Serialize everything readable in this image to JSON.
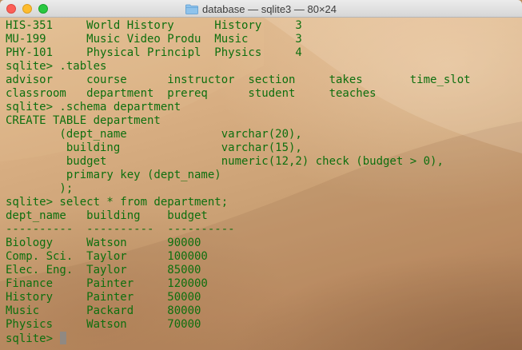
{
  "window": {
    "title": "database — sqlite3 — 80×24"
  },
  "icons": {
    "title": "folder-icon",
    "close": "close-icon",
    "minimize": "minimize-icon",
    "zoom": "zoom-icon"
  },
  "colors": {
    "terminal_text": "#0e6f0e",
    "close": "#fc5f57",
    "minimize": "#fdbc2e",
    "zoom": "#29c840"
  },
  "terminal": {
    "lines": [
      "HIS-351     World History      History     3",
      "MU-199      Music Video Produ  Music       3",
      "PHY-101     Physical Principl  Physics     4",
      "sqlite> .tables",
      "advisor     course      instructor  section     takes       time_slot",
      "classroom   department  prereq      student     teaches",
      "sqlite> .schema department",
      "CREATE TABLE department",
      "        (dept_name              varchar(20),",
      "         building               varchar(15),",
      "         budget                 numeric(12,2) check (budget > 0),",
      "         primary key (dept_name)",
      "        );",
      "sqlite> select * from department;",
      "dept_name   building    budget",
      "----------  ----------  ----------",
      "Biology     Watson      90000",
      "Comp. Sci.  Taylor      100000",
      "Elec. Eng.  Taylor      85000",
      "Finance     Painter     120000",
      "History     Painter     50000",
      "Music       Packard     80000",
      "Physics     Watson      70000"
    ],
    "prompt": "sqlite> "
  }
}
